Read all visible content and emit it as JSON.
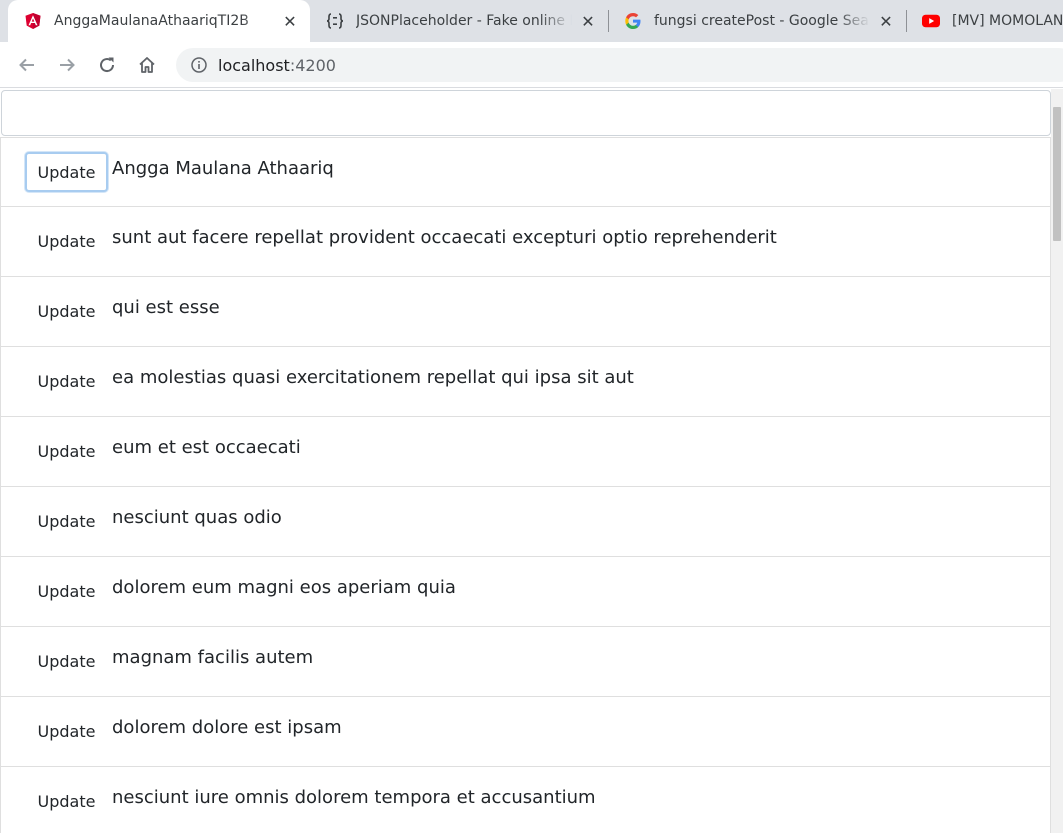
{
  "browser": {
    "tabs": [
      {
        "title": "AnggaMaulanaAthaariqTI2B",
        "icon": "angular-icon",
        "active": true
      },
      {
        "title": "JSONPlaceholder - Fake online REST API",
        "icon": "jsonplaceholder-icon",
        "active": false
      },
      {
        "title": "fungsi createPost - Google Search",
        "icon": "google-icon",
        "active": false
      },
      {
        "title": "[MV] MOMOLAND",
        "icon": "youtube-icon",
        "active": false
      }
    ],
    "close_glyph": "✕",
    "url_host": "localhost",
    "url_port": ":4200"
  },
  "posts": {
    "button_label": "Update",
    "items": [
      "Angga Maulana Athaariq",
      "sunt aut facere repellat provident occaecati excepturi optio reprehenderit",
      "qui est esse",
      "ea molestias quasi exercitationem repellat qui ipsa sit aut",
      "eum et est occaecati",
      "nesciunt quas odio",
      "dolorem eum magni eos aperiam quia",
      "magnam facilis autem",
      "dolorem dolore est ipsam",
      "nesciunt iure omnis dolorem tempora et accusantium"
    ]
  },
  "colors": {
    "angular": "#dd0031",
    "youtube": "#ff0000",
    "focus_ring": "#a8ccf0"
  }
}
